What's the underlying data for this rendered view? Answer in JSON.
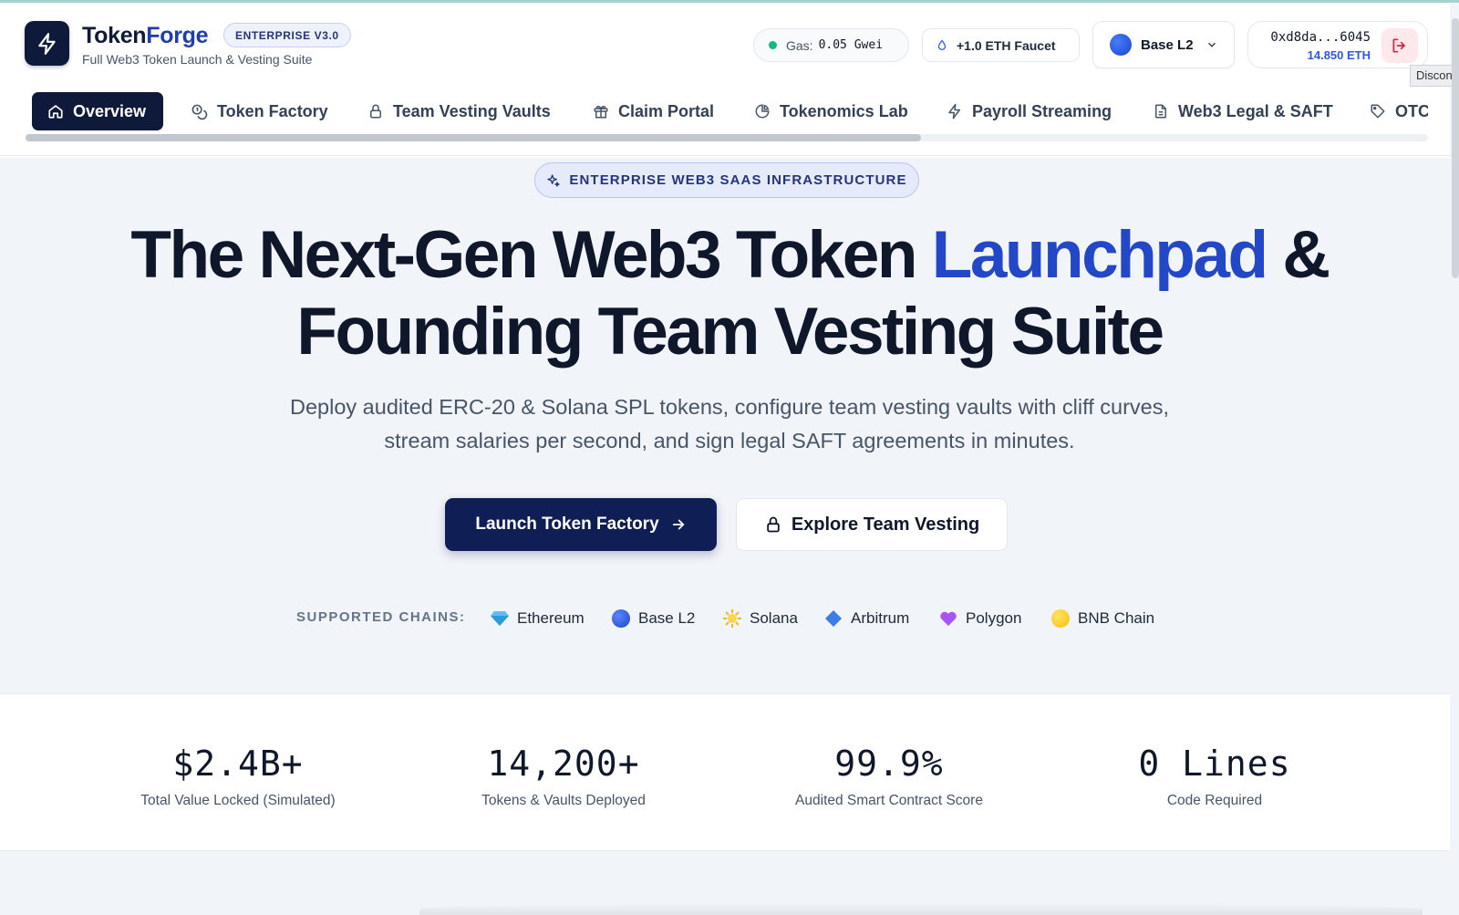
{
  "header": {
    "brand": {
      "name_a": "Token",
      "name_b": "Forge",
      "edition": "ENTERPRISE V3.0",
      "subtitle": "Full Web3 Token Launch & Vesting Suite"
    },
    "gas": {
      "label": "Gas:",
      "value": "0.05 Gwei",
      "status_color": "#10b981"
    },
    "faucet_label": "+1.0 ETH Faucet",
    "network": {
      "selected": "Base L2"
    },
    "wallet": {
      "address": "0xd8da...6045",
      "balance": "14.850 ETH",
      "disconnect_tooltip": "Disconnect"
    }
  },
  "nav": {
    "items": [
      {
        "label": "Overview",
        "icon": "home-icon",
        "active": true
      },
      {
        "label": "Token Factory",
        "icon": "coins-icon"
      },
      {
        "label": "Team Vesting Vaults",
        "icon": "lock-icon"
      },
      {
        "label": "Claim Portal",
        "icon": "gift-icon"
      },
      {
        "label": "Tokenomics Lab",
        "icon": "pie-chart-icon"
      },
      {
        "label": "Payroll Streaming",
        "icon": "zap-icon"
      },
      {
        "label": "Web3 Legal & SAFT",
        "icon": "file-text-icon"
      },
      {
        "label": "OTC",
        "icon": "tag-icon"
      }
    ]
  },
  "hero": {
    "pill": "ENTERPRISE WEB3 SAAS INFRASTRUCTURE",
    "title_1": "The Next-Gen Web3 Token ",
    "title_accent": "Launchpad",
    "title_2": " &",
    "title_3": "Founding Team Vesting Suite",
    "description": "Deploy audited ERC-20 & Solana SPL tokens, configure team vesting vaults with cliff curves, stream salaries per second, and sign legal SAFT agreements in minutes.",
    "primary_cta": "Launch Token Factory",
    "secondary_cta": "Explore Team Vesting"
  },
  "chains": {
    "label": "SUPPORTED CHAINS:",
    "items": [
      {
        "name": "Ethereum",
        "icon": "gem-icon"
      },
      {
        "name": "Base L2",
        "icon": "blue-circle-icon"
      },
      {
        "name": "Solana",
        "icon": "sun-icon"
      },
      {
        "name": "Arbitrum",
        "icon": "diamond-icon"
      },
      {
        "name": "Polygon",
        "icon": "purple-heart-icon"
      },
      {
        "name": "BNB Chain",
        "icon": "yellow-circle-icon"
      }
    ]
  },
  "stats": [
    {
      "value": "$2.4B+",
      "label": "Total Value Locked (Simulated)"
    },
    {
      "value": "14,200+",
      "label": "Tokens & Vaults Deployed"
    },
    {
      "value": "99.9%",
      "label": "Audited Smart Contract Score"
    },
    {
      "value": "0 Lines",
      "label": "Code Required"
    }
  ],
  "colors": {
    "brand_navy": "#0f1a3a",
    "accent_blue": "#2248c8",
    "disconnect_red": "#e11d48"
  }
}
